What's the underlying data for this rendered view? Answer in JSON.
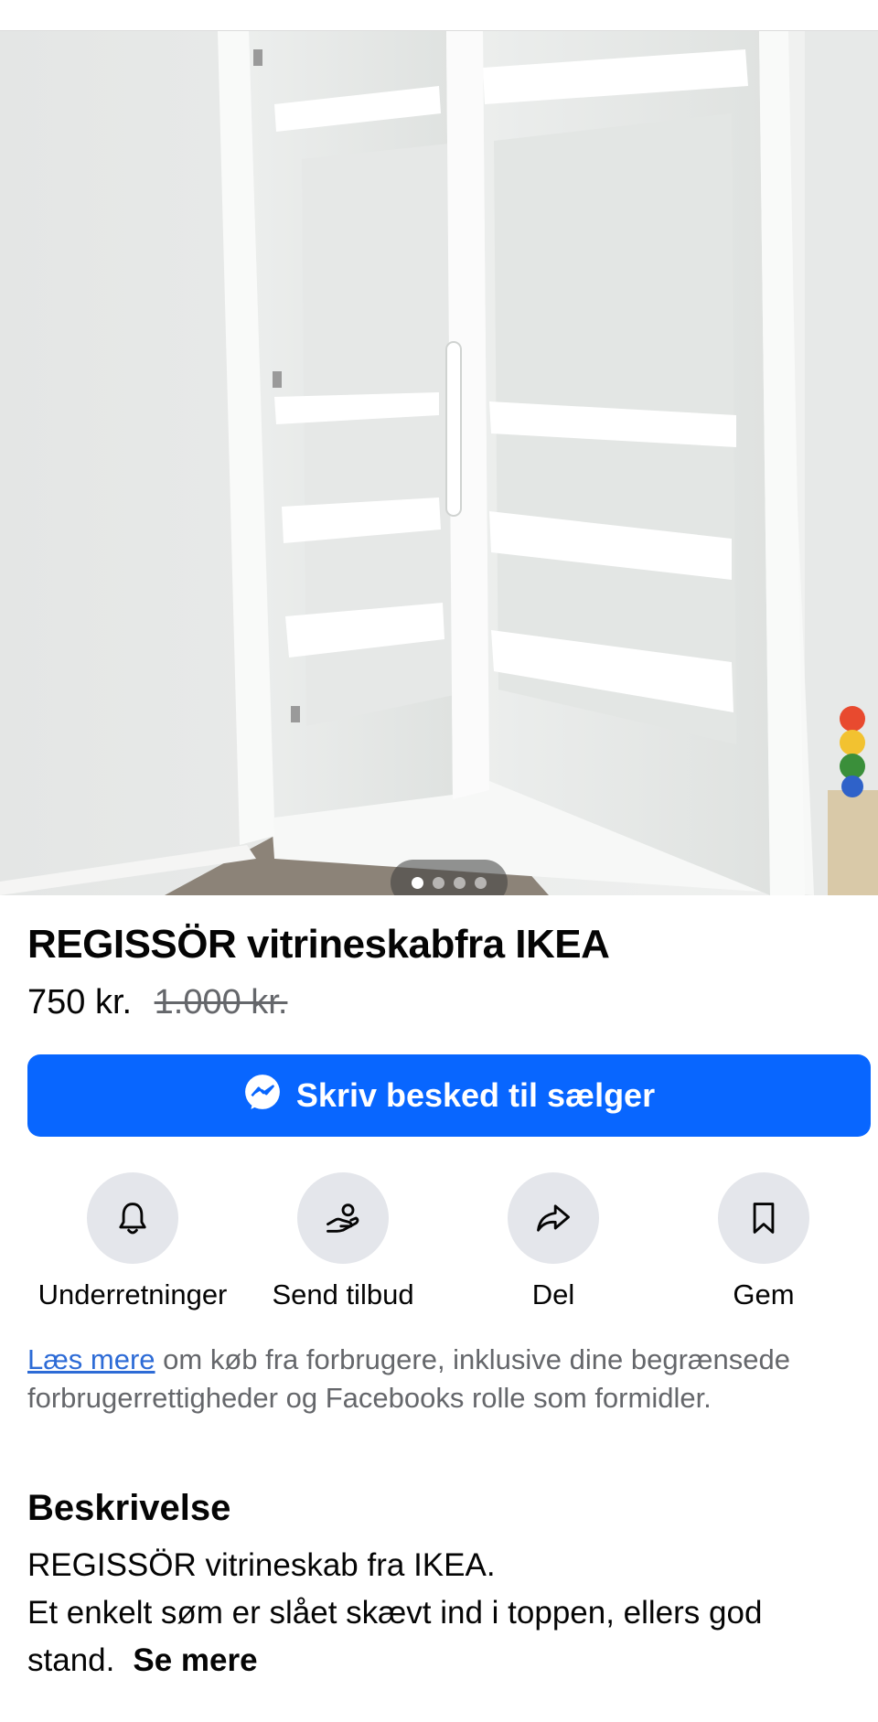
{
  "listing": {
    "title": "REGISSÖR vitrineskabfra IKEA",
    "price": "750 kr.",
    "original_price": "1.000 kr.",
    "photo_count": 4,
    "active_photo_index": 0
  },
  "message_button": {
    "label": "Skriv besked til sælger",
    "icon": "messenger-icon",
    "color": "#0866ff"
  },
  "actions": [
    {
      "label": "Underretninger",
      "icon": "bell-icon"
    },
    {
      "label": "Send tilbud",
      "icon": "offer-hand-icon"
    },
    {
      "label": "Del",
      "icon": "share-arrow-icon"
    },
    {
      "label": "Gem",
      "icon": "bookmark-icon"
    }
  ],
  "legal": {
    "link_text": "Læs mere",
    "text": " om køb fra forbrugere, inklusive dine begrænsede forbrugerrettigheder og Facebooks rolle som formidler."
  },
  "description": {
    "heading": "Beskrivelse",
    "line1": "REGISSÖR vitrineskab fra IKEA.",
    "line2": "Et enkelt søm er slået skævt ind i toppen, ellers god stand.",
    "see_more": "Se mere"
  }
}
